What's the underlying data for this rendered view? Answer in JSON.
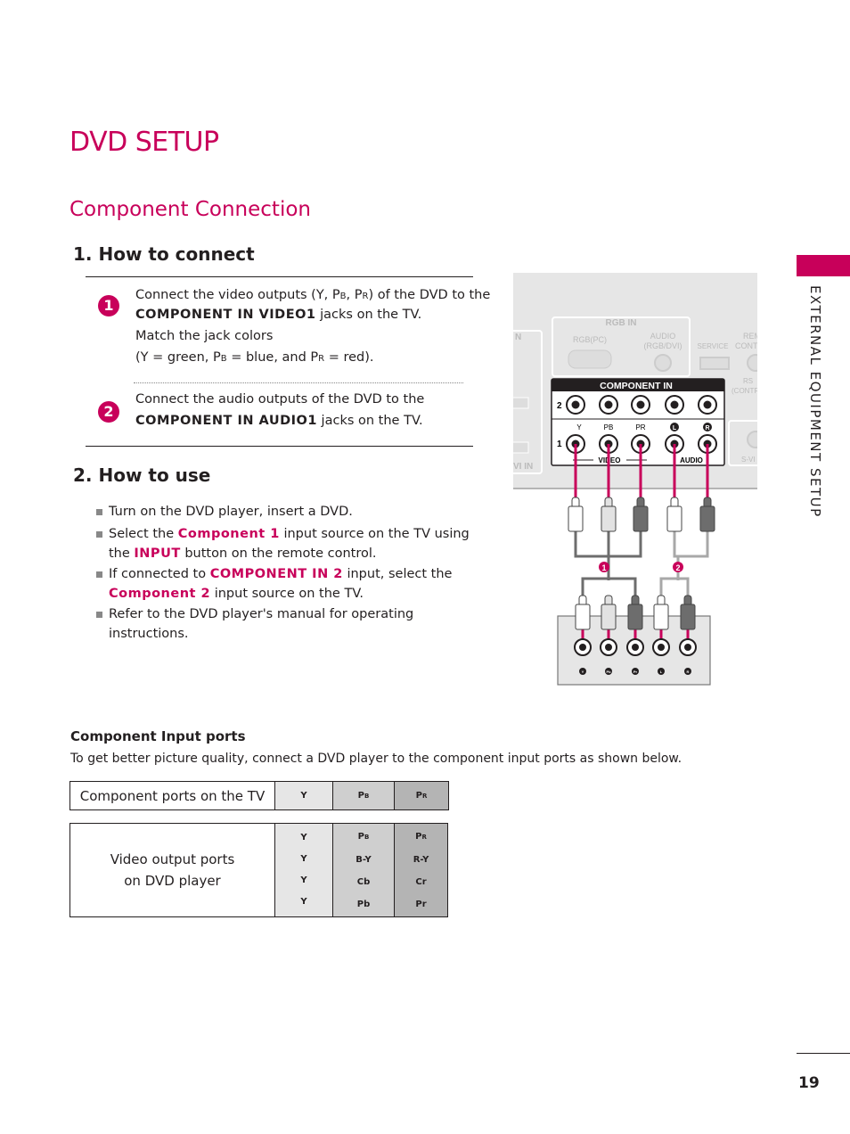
{
  "page": {
    "title": "DVD SETUP",
    "subtitle": "Component Connection",
    "side_tab": "EXTERNAL EQUIPMENT SETUP",
    "page_number": "19",
    "accent_color": "#c8005a"
  },
  "how_to_connect": {
    "heading": "1. How to connect",
    "steps": [
      {
        "number": "1",
        "line1_a": "Connect the video outputs (Y, P",
        "line1_b": "B",
        "line1_c": ", P",
        "line1_d": "R",
        "line1_e": ")  of the DVD to the",
        "line2_bold": "COMPONENT IN VIDEO1",
        "line2_rest": " jacks on the TV.",
        "line3": "Match the jack colors",
        "line4_a": "(Y = green, P",
        "line4_b": "B",
        "line4_c": " = blue, and P",
        "line4_d": "R",
        "line4_e": " = red)."
      },
      {
        "number": "2",
        "line1": "Connect the audio outputs of the DVD to the",
        "line2_bold": "COMPONENT IN AUDIO1",
        "line2_rest": " jacks on the TV."
      }
    ]
  },
  "how_to_use": {
    "heading": "2. How to use",
    "b1": "Turn on the DVD player, insert a DVD.",
    "b2_a": "Select the ",
    "b2_hl": "Component 1",
    "b2_b": " input source on the TV using",
    "b2_c": "the ",
    "b2_hl2": "INPUT",
    "b2_d": " button on the remote control.",
    "b3_a": "If connected to ",
    "b3_hl": "COMPONENT IN 2",
    "b3_b": " input, select the",
    "b3_hl2": "Component 2",
    "b3_c": " input source on the TV.",
    "b4": "Refer to the DVD player's manual for operating instructions."
  },
  "diagram": {
    "panel_labels": {
      "rgb_in": "RGB IN",
      "rgb_pc": "RGB(PC)",
      "audio_rgb_dvi_1": "AUDIO",
      "audio_rgb_dvi_2": "(RGB/DVI)",
      "service": "SERVICE",
      "remote_1": "REM",
      "remote_2": "CONT",
      "rs_1": "RS",
      "rs_2": "(CONTR",
      "svideo": "S-VI",
      "in_left": "N",
      "dvi_in": "VI IN",
      "component_in": "COMPONENT IN",
      "row2": "2",
      "row1": "1",
      "jack_y": "Y",
      "jack_pb": "PB",
      "jack_pr": "PR",
      "jack_l": "L",
      "jack_r": "R",
      "video": "VIDEO",
      "audio": "AUDIO"
    },
    "cable_markers": [
      "1",
      "2"
    ],
    "dvd_jacks": [
      "Y",
      "Pb",
      "Pr",
      "L",
      "R"
    ]
  },
  "component_ports": {
    "title": "Component Input ports",
    "description": "To get better picture quality, connect a DVD player to the component input ports as shown below.",
    "tv_row": {
      "label": "Component ports on the TV",
      "cells": [
        {
          "main": "Y",
          "sub": ""
        },
        {
          "main": "P",
          "sub": "B"
        },
        {
          "main": "P",
          "sub": "R"
        }
      ]
    },
    "dvd_rows": {
      "label_line1": "Video output ports",
      "label_line2": "on DVD player",
      "col_y": [
        "Y",
        "Y",
        "Y",
        "Y"
      ],
      "col_pb": [
        {
          "main": "P",
          "sub": "B"
        },
        {
          "main": "B-Y",
          "sub": ""
        },
        {
          "main": "Cb",
          "sub": ""
        },
        {
          "main": "Pb",
          "sub": ""
        }
      ],
      "col_pr": [
        {
          "main": "P",
          "sub": "R"
        },
        {
          "main": "R-Y",
          "sub": ""
        },
        {
          "main": "Cr",
          "sub": ""
        },
        {
          "main": "Pr",
          "sub": ""
        }
      ]
    }
  }
}
